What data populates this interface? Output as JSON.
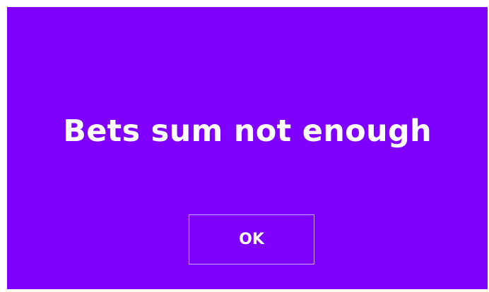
{
  "theme": {
    "background": "#7f00ff",
    "text_color": "#ffffff",
    "button_border": "#c9a6ff"
  },
  "dialog": {
    "message": "Bets sum not enough",
    "ok_label": "OK"
  }
}
